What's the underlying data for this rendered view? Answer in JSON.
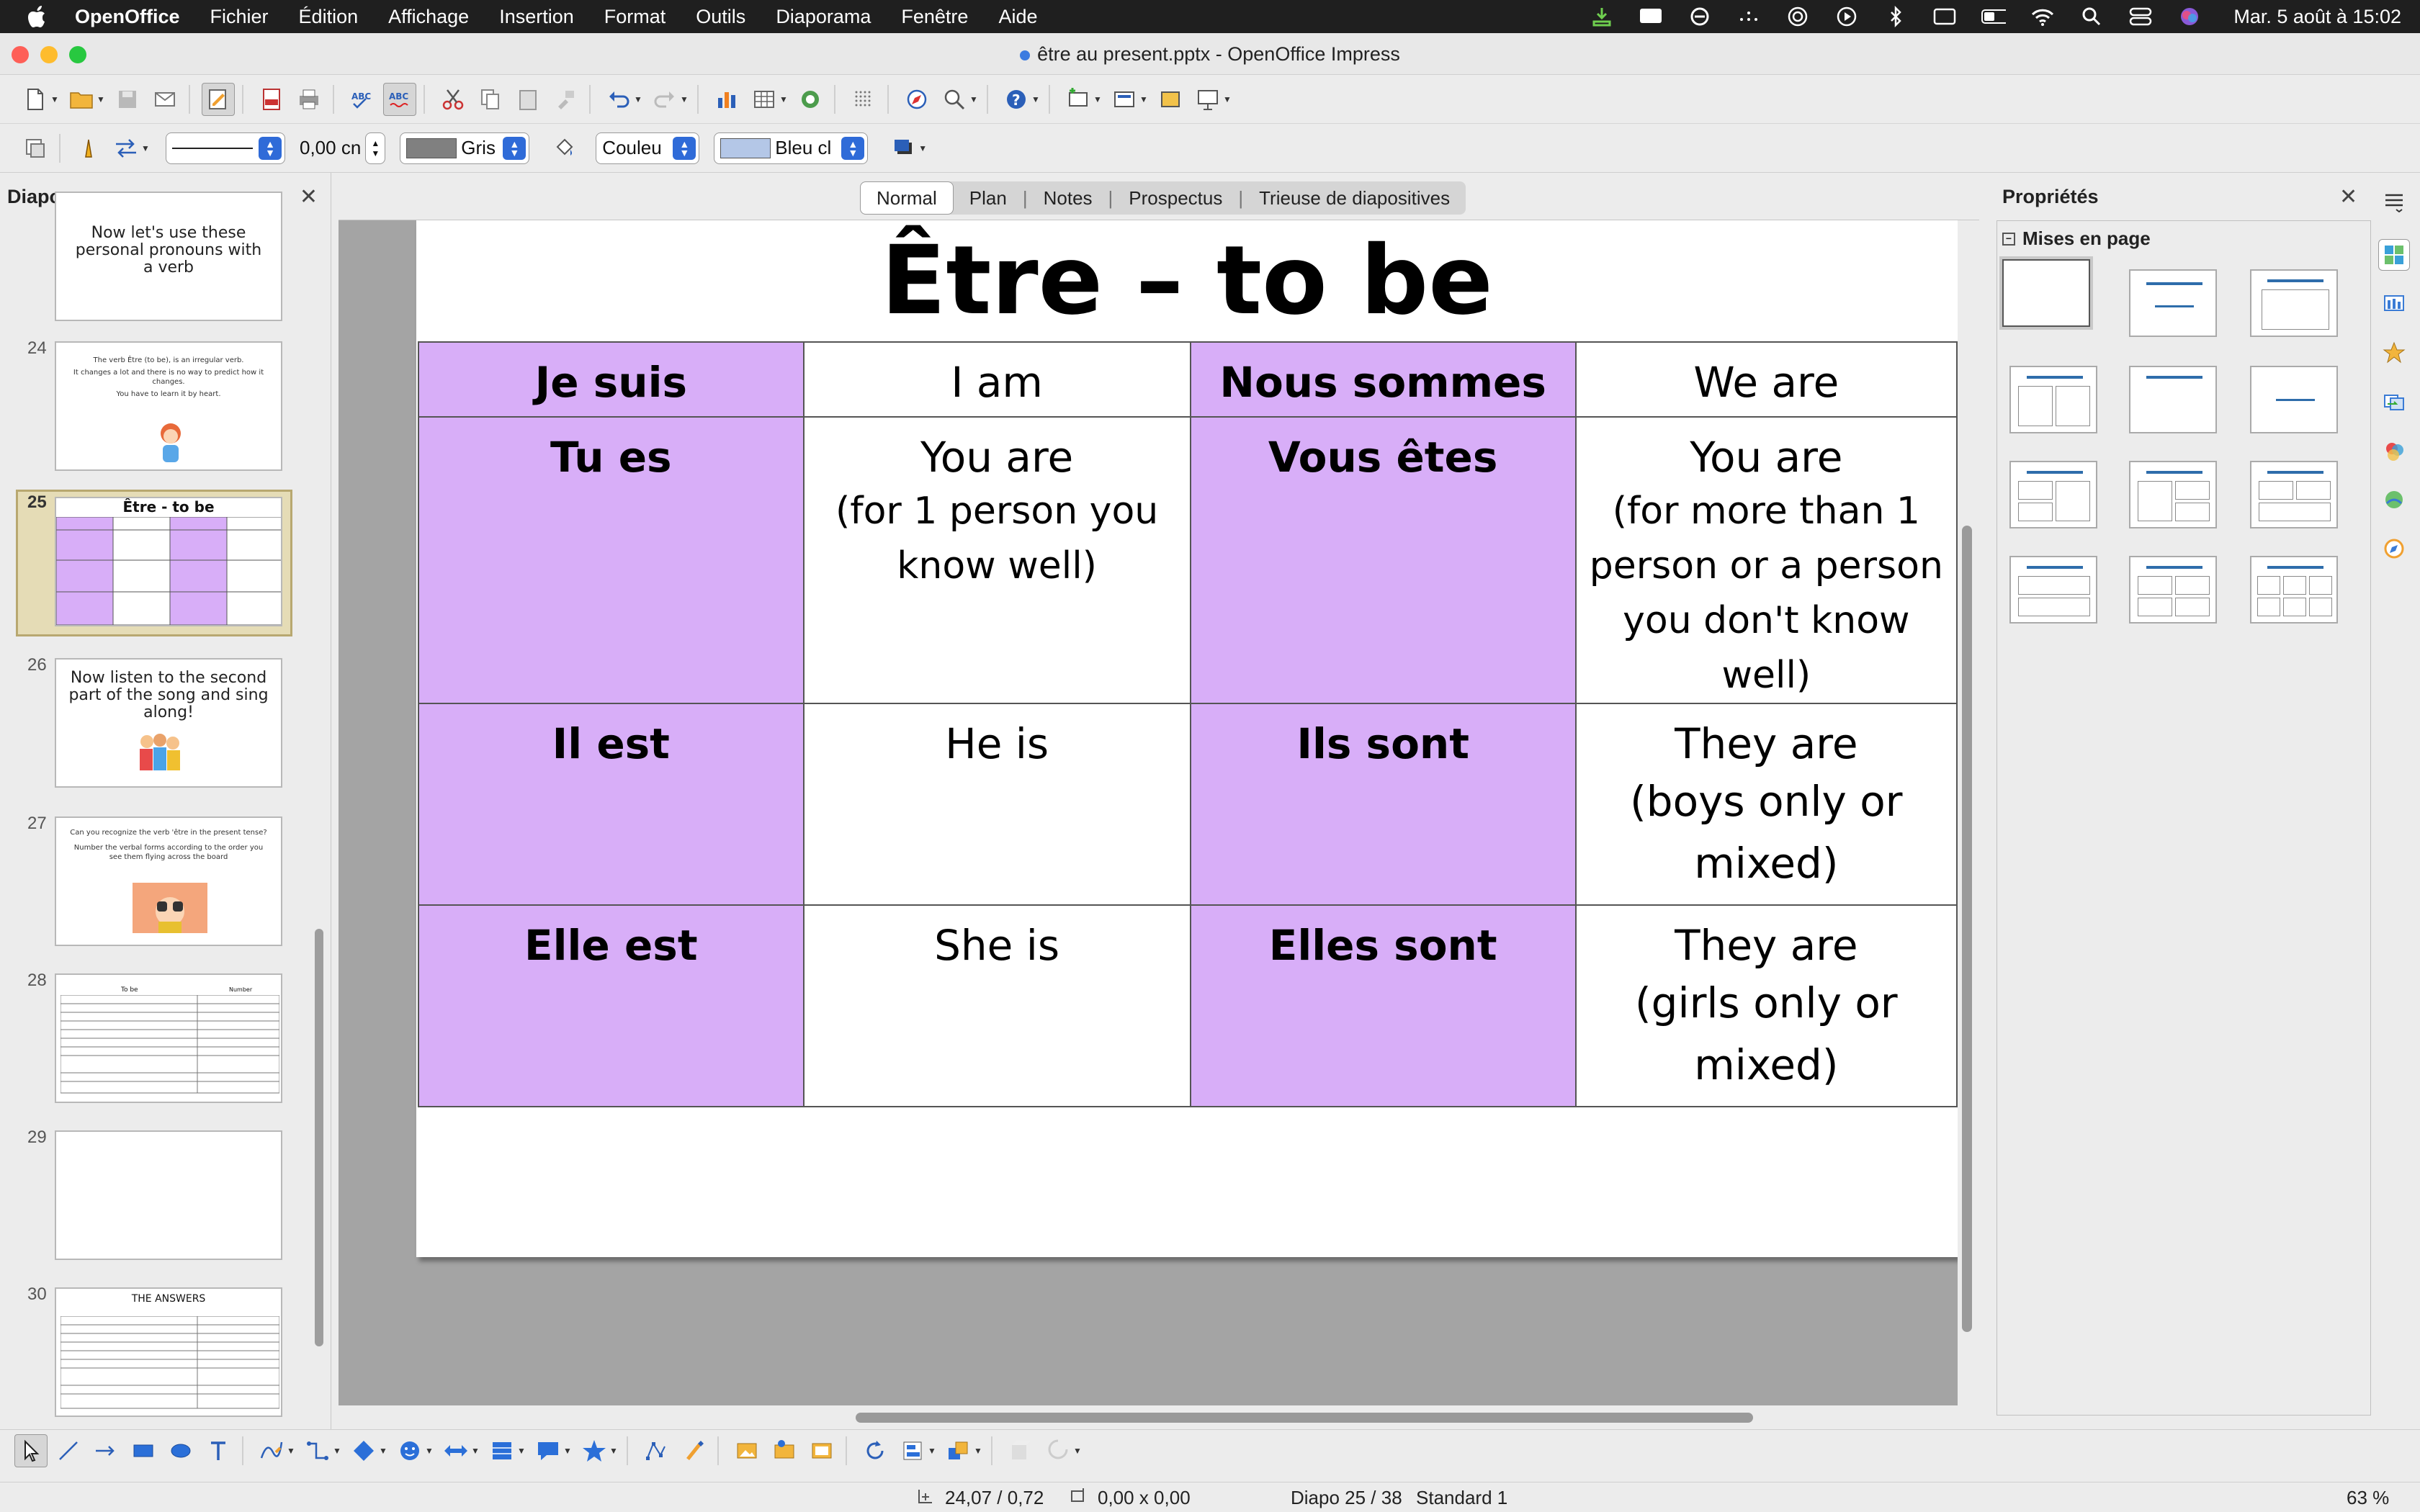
{
  "menubar": {
    "app_name": "OpenOffice",
    "items": [
      "Fichier",
      "Édition",
      "Affichage",
      "Insertion",
      "Format",
      "Outils",
      "Diaporama",
      "Fenêtre",
      "Aide"
    ],
    "clock": "Mar. 5 août à  15:02"
  },
  "window": {
    "title": "être au present.pptx - OpenOffice Impress"
  },
  "format_bar": {
    "line_width": "0,00 cn",
    "line_color": "Gris",
    "fill_type": "Couleu",
    "fill_color": "Bleu cl"
  },
  "slides_pane": {
    "title": "Diapos",
    "thumbnails": [
      {
        "number": "",
        "lines": [
          "Now let's use these",
          "personal pronouns with",
          "a verb"
        ]
      },
      {
        "number": "24",
        "lines": [
          "The verb Être (to be), is an irregular verb.",
          "It changes a lot and there is no way to predict how it changes.",
          "You have to learn it by heart."
        ]
      },
      {
        "number": "25",
        "lines": [
          "Être - to be"
        ],
        "selected": true
      },
      {
        "number": "26",
        "lines": [
          "Now listen to the second",
          "part of the song and sing",
          "along!"
        ]
      },
      {
        "number": "27",
        "lines": [
          "Can you recognize the verb 'être in the present tense?",
          "Number the verbal forms according to the order you see them flying across the board"
        ]
      },
      {
        "number": "28",
        "lines": [
          "To be",
          "Number"
        ]
      },
      {
        "number": "29",
        "lines": []
      },
      {
        "number": "30",
        "lines": [
          "THE ANSWERS"
        ]
      }
    ]
  },
  "view_tabs": [
    "Normal",
    "Plan",
    "Notes",
    "Prospectus",
    "Trieuse de diapositives"
  ],
  "slide": {
    "title": "Être – to be",
    "rows": [
      {
        "fr1": "Je suis",
        "en1": "I am",
        "fr2": "Nous sommes",
        "en2": "We are"
      },
      {
        "fr1": "Tu es",
        "en1": "You are",
        "en1_note": "(for 1 person you know well)",
        "fr2": "Vous êtes",
        "en2": "You are",
        "en2_note": "(for more than 1 person or a person you don't know well)"
      },
      {
        "fr1": "Il est",
        "en1": "He is",
        "fr2": "Ils sont",
        "en2": "They are",
        "en2_note": "(boys only or mixed)"
      },
      {
        "fr1": "Elle est",
        "en1": "She is",
        "fr2": "Elles sont",
        "en2": "They are",
        "en2_note": "(girls only or mixed)"
      }
    ]
  },
  "properties": {
    "title": "Propriétés",
    "section": "Mises en page"
  },
  "statusbar": {
    "position": "24,07 / 0,72",
    "size": "0,00 x 0,00",
    "slide": "Diapo 25 / 38",
    "master": "Standard 1",
    "zoom": "63 %"
  },
  "colors": {
    "fr_cell": "#d8aef8",
    "accent": "#2f6bd8",
    "thumb_selected": "#e5dcb6"
  }
}
